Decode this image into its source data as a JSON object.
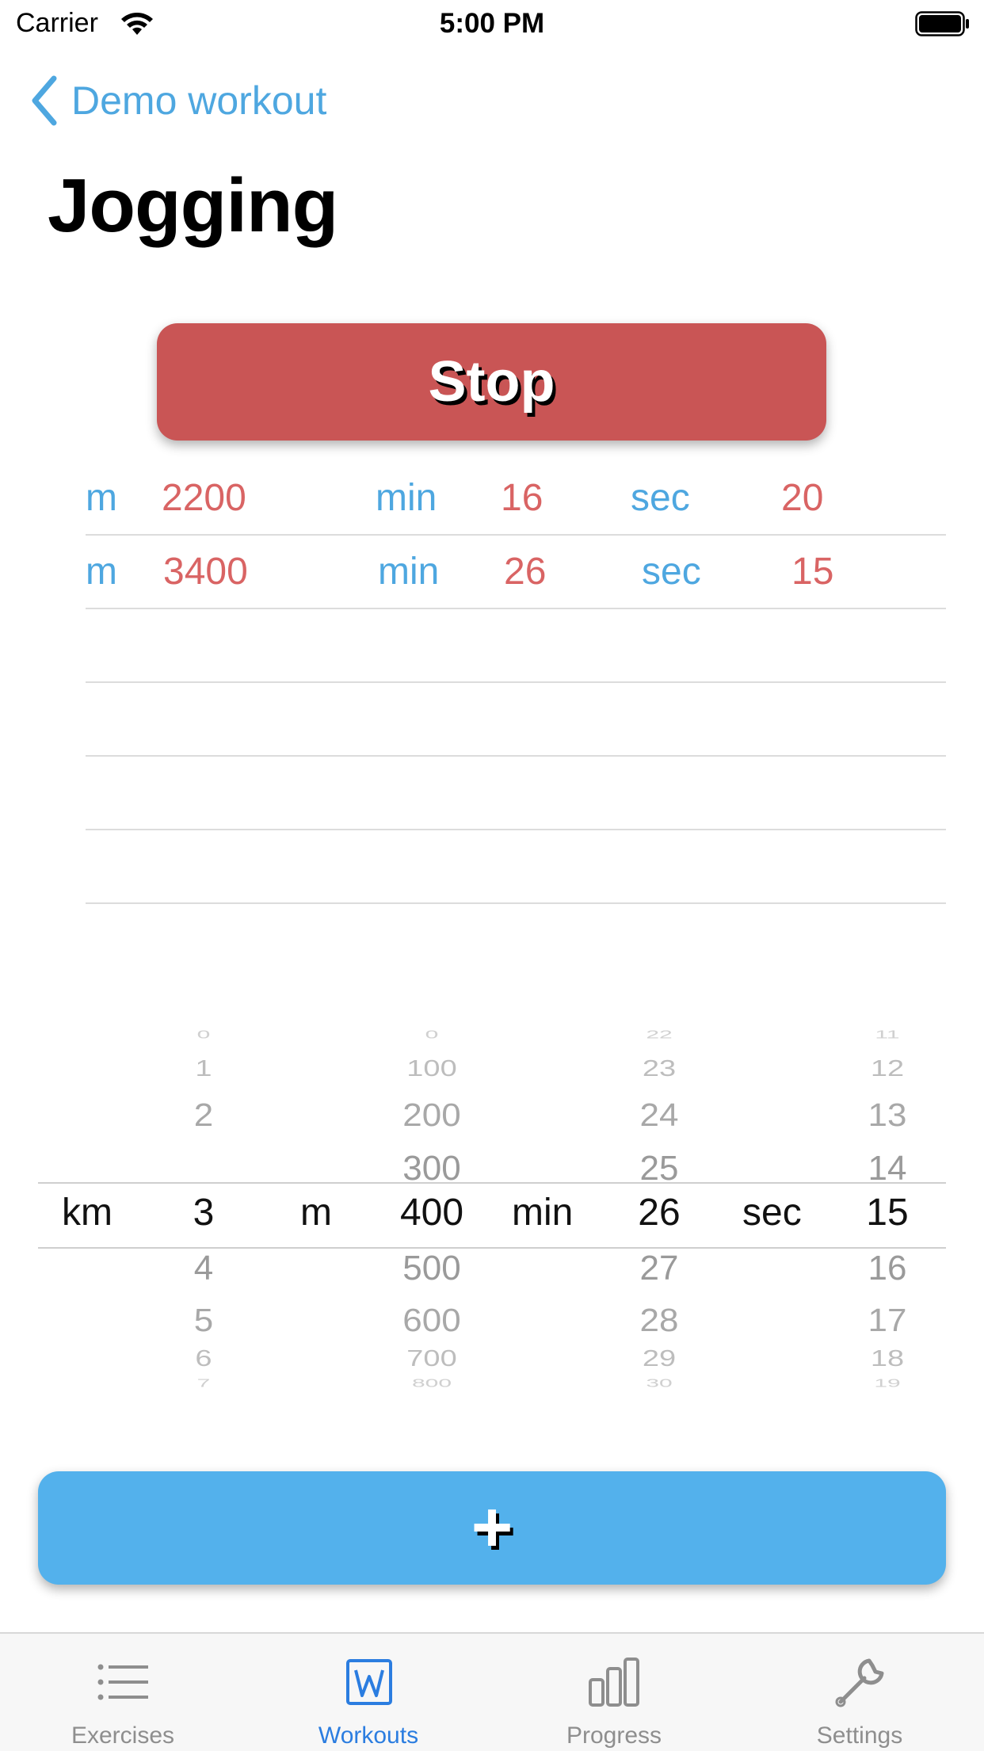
{
  "status_bar": {
    "carrier": "Carrier",
    "time": "5:00 PM"
  },
  "nav": {
    "back_label": "Demo workout"
  },
  "title": "Jogging",
  "stop_button": {
    "label": "Stop"
  },
  "log": {
    "rows": [
      {
        "dist_unit": "m",
        "dist": "2200",
        "min_unit": "min",
        "min": "16",
        "sec_unit": "sec",
        "sec": "20"
      },
      {
        "dist_unit": "m",
        "dist": "3400",
        "min_unit": "min",
        "min": "26",
        "sec_unit": "sec",
        "sec": "15"
      }
    ]
  },
  "picker": {
    "units": {
      "km": "km",
      "m": "m",
      "min": "min",
      "sec": "sec"
    },
    "km": {
      "above": [
        "0",
        "1",
        "2"
      ],
      "selected": "3",
      "below": [
        "4",
        "5",
        "6",
        "7"
      ]
    },
    "m": {
      "above": [
        "0",
        "100",
        "200",
        "300"
      ],
      "selected": "400",
      "below": [
        "500",
        "600",
        "700",
        "800"
      ]
    },
    "min": {
      "above": [
        "22",
        "23",
        "24",
        "25"
      ],
      "selected": "26",
      "below": [
        "27",
        "28",
        "29",
        "30"
      ]
    },
    "sec": {
      "above": [
        "11",
        "12",
        "13",
        "14"
      ],
      "selected": "15",
      "below": [
        "16",
        "17",
        "18",
        "19"
      ]
    }
  },
  "add_button": {
    "label": "+"
  },
  "tabbar": {
    "tabs": [
      {
        "label": "Exercises",
        "icon": "list-icon"
      },
      {
        "label": "Workouts",
        "icon": "workouts-w-icon"
      },
      {
        "label": "Progress",
        "icon": "bar-chart-icon"
      },
      {
        "label": "Settings",
        "icon": "wrench-icon"
      }
    ]
  },
  "colors": {
    "accent_blue": "#4ea7e0",
    "stop_red": "#c95555",
    "value_red": "#d96464",
    "add_blue": "#53b1ec",
    "tab_active": "#2b7de0"
  }
}
